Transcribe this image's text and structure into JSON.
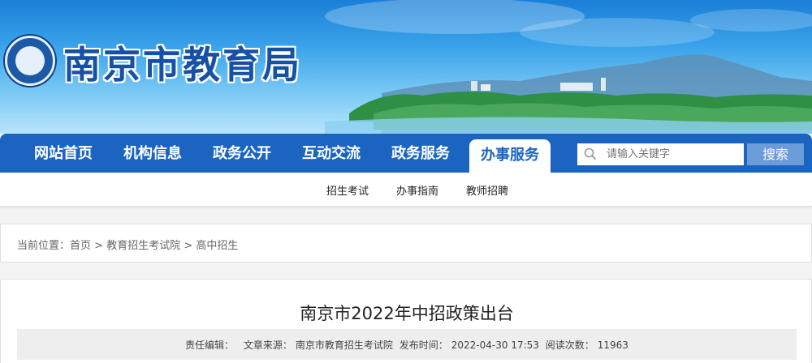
{
  "header": {
    "site_title": "南京市教育局",
    "logo_alt": "emblem-logo"
  },
  "nav": {
    "items": [
      {
        "label": "网站首页",
        "active": false
      },
      {
        "label": "机构信息",
        "active": false
      },
      {
        "label": "政务公开",
        "active": false
      },
      {
        "label": "互动交流",
        "active": false
      },
      {
        "label": "政务服务",
        "active": false
      },
      {
        "label": "办事服务",
        "active": true
      }
    ]
  },
  "search": {
    "placeholder": "请输入关键字",
    "button_label": "搜索"
  },
  "subnav": {
    "items": [
      "招生考试",
      "办事指南",
      "教师招聘"
    ]
  },
  "breadcrumb": {
    "prefix": "当前位置：",
    "items": [
      "首页",
      "教育招生考试院",
      "高中招生"
    ],
    "separator": " > "
  },
  "article": {
    "title": "南京市2022年中招政策出台",
    "meta": {
      "editor_label": "责任编辑：",
      "editor_value": "",
      "source_label": "文章来源：",
      "source_value": "南京市教育招生考试院",
      "publish_label": "发布时间：",
      "publish_value": "2022-04-30 17:53",
      "views_label": "阅读次数：",
      "views_value": "11963"
    }
  },
  "colors": {
    "nav_bg": "#1b64c0",
    "title_blue": "#1751a6",
    "search_button": "#6c9bd9"
  }
}
